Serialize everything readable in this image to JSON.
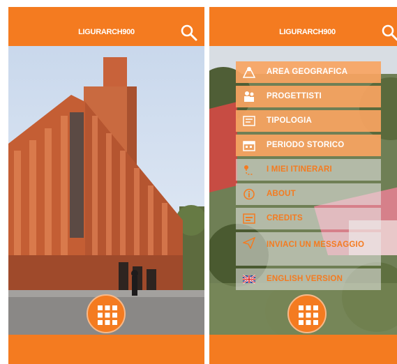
{
  "app": {
    "title": "LIGURARCH900",
    "accent_color": "#f47b20",
    "icons": {
      "search": "search-icon",
      "grid": "grid-menu-icon"
    }
  },
  "left_screen": {
    "photo": "brick-building-photo"
  },
  "right_screen": {
    "menu": [
      {
        "label": "AREA GEOGRAFICA",
        "icon": "map-area-icon",
        "highlighted": true
      },
      {
        "label": "PROGETTISTI",
        "icon": "designers-icon",
        "highlighted": true
      },
      {
        "label": "TIPOLOGIA",
        "icon": "typology-icon",
        "highlighted": true
      },
      {
        "label": "PERIODO STORICO",
        "icon": "calendar-icon",
        "highlighted": true
      },
      {
        "label": "I MIEI ITINERARI",
        "icon": "itinerary-icon",
        "highlighted": false
      },
      {
        "label": "ABOUT",
        "icon": "info-icon",
        "highlighted": false
      },
      {
        "label": "CREDITS",
        "icon": "credits-icon",
        "highlighted": false
      },
      {
        "label": "INVIACI UN MESSAGGIO",
        "icon": "send-message-icon",
        "highlighted": false
      },
      {
        "label": "ENGLISH VERSION",
        "icon": "uk-flag-icon",
        "highlighted": false
      }
    ]
  }
}
